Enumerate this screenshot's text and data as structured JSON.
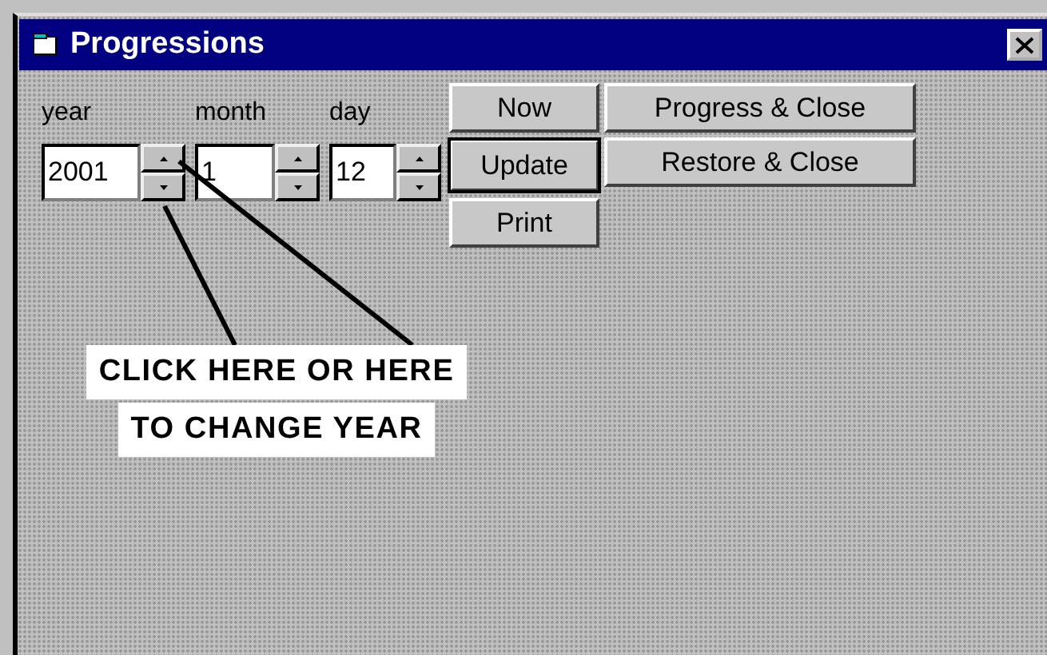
{
  "window": {
    "title": "Progressions"
  },
  "fields": [
    {
      "label": "year",
      "value": "2001",
      "kind": "spin"
    },
    {
      "label": "month",
      "value": "1",
      "kind": "spin"
    },
    {
      "label": "day",
      "value": "12",
      "kind": "spin"
    }
  ],
  "button_columns": [
    [
      {
        "label": "Now",
        "default": false
      },
      {
        "label": "Update",
        "default": true
      },
      {
        "label": "Print",
        "default": false
      }
    ],
    [
      {
        "label": "Progress & Close",
        "default": false
      },
      {
        "label": "Restore & Close",
        "default": false
      }
    ]
  ],
  "callout": {
    "lines": [
      "CLICK HERE OR HERE",
      "TO CHANGE YEAR"
    ]
  }
}
